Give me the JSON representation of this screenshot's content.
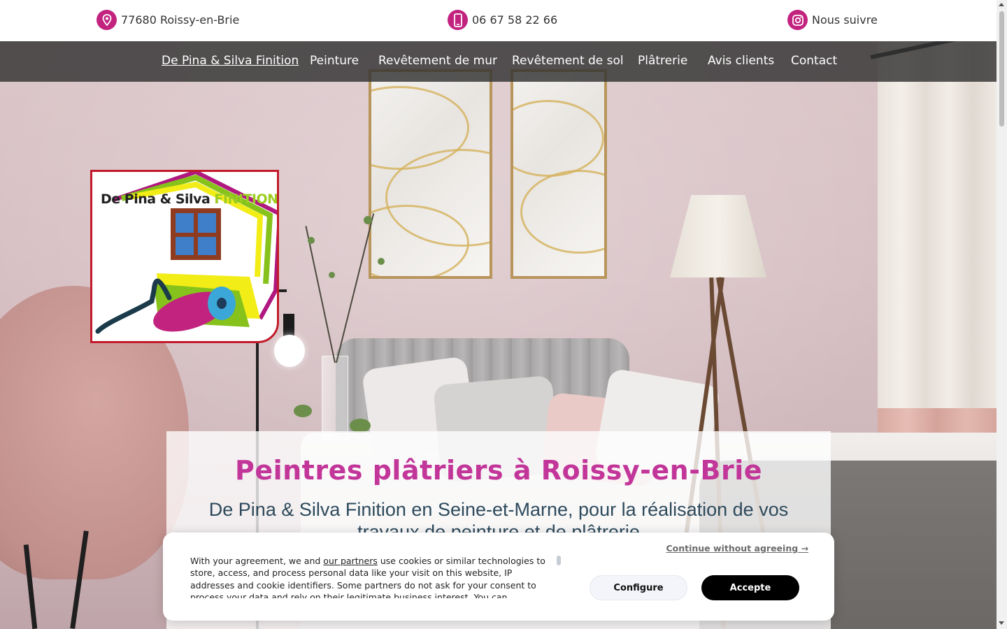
{
  "topbar": {
    "location": "77680 Roissy-en-Brie",
    "phone": "06 67 58 22 66",
    "social": "Nous suivre"
  },
  "nav": {
    "items": [
      {
        "label": "De Pina & Silva Finition",
        "active": true
      },
      {
        "label": "Peinture",
        "active": false
      },
      {
        "label": "Revêtement de mur",
        "active": false
      },
      {
        "label": "Revêtement de sol",
        "active": false
      },
      {
        "label": "Plâtrerie",
        "active": false
      },
      {
        "label": "Avis clients",
        "active": false
      },
      {
        "label": "Contact",
        "active": false
      }
    ]
  },
  "logo": {
    "text_main": "De Pina & Silva",
    "text_accent": "FINITION"
  },
  "hero": {
    "title": "Peintres plâtriers à Roissy-en-Brie",
    "subtitle": "De Pina & Silva Finition en Seine-et-Marne, pour la réalisation de vos travaux de peinture et de plâtrerie"
  },
  "cookie": {
    "text_before_link": "With your agreement, we and ",
    "link": "our partners",
    "text_after_link": " use cookies or similar technologies to store, access, and process personal data like your visit on this website, IP addresses and cookie identifiers. Some partners do not ask for your consent to process your data and rely on their legitimate business interest. You can",
    "continue_label": "Continue without agreeing →",
    "configure_label": "Configure",
    "accept_label": "Accepte"
  },
  "colors": {
    "brand": "#c2237f",
    "title": "#c2369a",
    "subtitle": "#2d4a5c",
    "nav_bg": "#323232"
  },
  "icons": {
    "location": "map-pin-icon",
    "phone": "smartphone-icon",
    "social": "instagram-icon"
  }
}
